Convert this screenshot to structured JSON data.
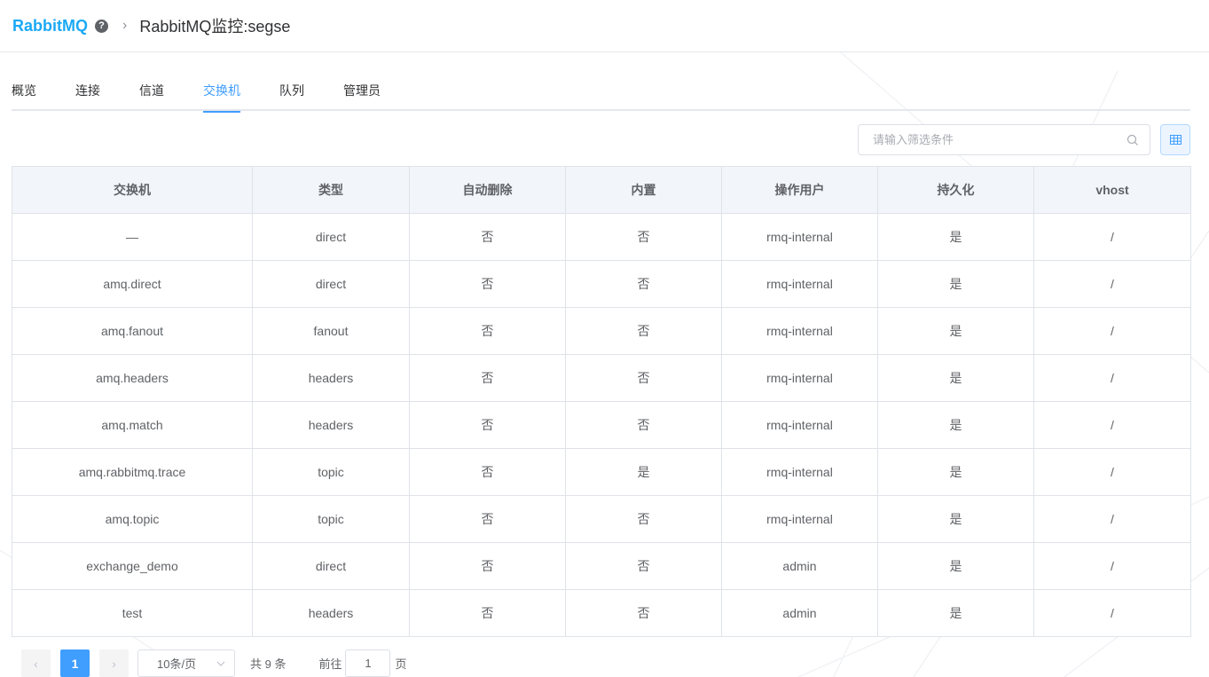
{
  "header": {
    "brand": "RabbitMQ",
    "help_icon": "question-circle-icon",
    "separator": "›",
    "breadcrumb": "RabbitMQ监控:segse"
  },
  "tabs": [
    {
      "label": "概览",
      "active": false
    },
    {
      "label": "连接",
      "active": false
    },
    {
      "label": "信道",
      "active": false
    },
    {
      "label": "交换机",
      "active": true
    },
    {
      "label": "队列",
      "active": false
    },
    {
      "label": "管理员",
      "active": false
    }
  ],
  "toolbar": {
    "search_placeholder": "请输入筛选条件",
    "search_icon": "search-icon",
    "grid_icon": "table-grid-icon"
  },
  "table": {
    "columns": [
      "交换机",
      "类型",
      "自动删除",
      "内置",
      "操作用户",
      "持久化",
      "vhost"
    ],
    "rows": [
      [
        "—",
        "direct",
        "否",
        "否",
        "rmq-internal",
        "是",
        "/"
      ],
      [
        "amq.direct",
        "direct",
        "否",
        "否",
        "rmq-internal",
        "是",
        "/"
      ],
      [
        "amq.fanout",
        "fanout",
        "否",
        "否",
        "rmq-internal",
        "是",
        "/"
      ],
      [
        "amq.headers",
        "headers",
        "否",
        "否",
        "rmq-internal",
        "是",
        "/"
      ],
      [
        "amq.match",
        "headers",
        "否",
        "否",
        "rmq-internal",
        "是",
        "/"
      ],
      [
        "amq.rabbitmq.trace",
        "topic",
        "否",
        "是",
        "rmq-internal",
        "是",
        "/"
      ],
      [
        "amq.topic",
        "topic",
        "否",
        "否",
        "rmq-internal",
        "是",
        "/"
      ],
      [
        "exchange_demo",
        "direct",
        "否",
        "否",
        "admin",
        "是",
        "/"
      ],
      [
        "test",
        "headers",
        "否",
        "否",
        "admin",
        "是",
        "/"
      ]
    ]
  },
  "pagination": {
    "prev": "‹",
    "current_page": "1",
    "next": "›",
    "page_size": "10条/页",
    "total": "共 9 条",
    "jump_label": "前往",
    "jump_value": "1",
    "jump_suffix": "页"
  },
  "colors": {
    "brand": "#1ba9f5",
    "accent": "#409eff",
    "header_bg": "#f2f6fa"
  }
}
